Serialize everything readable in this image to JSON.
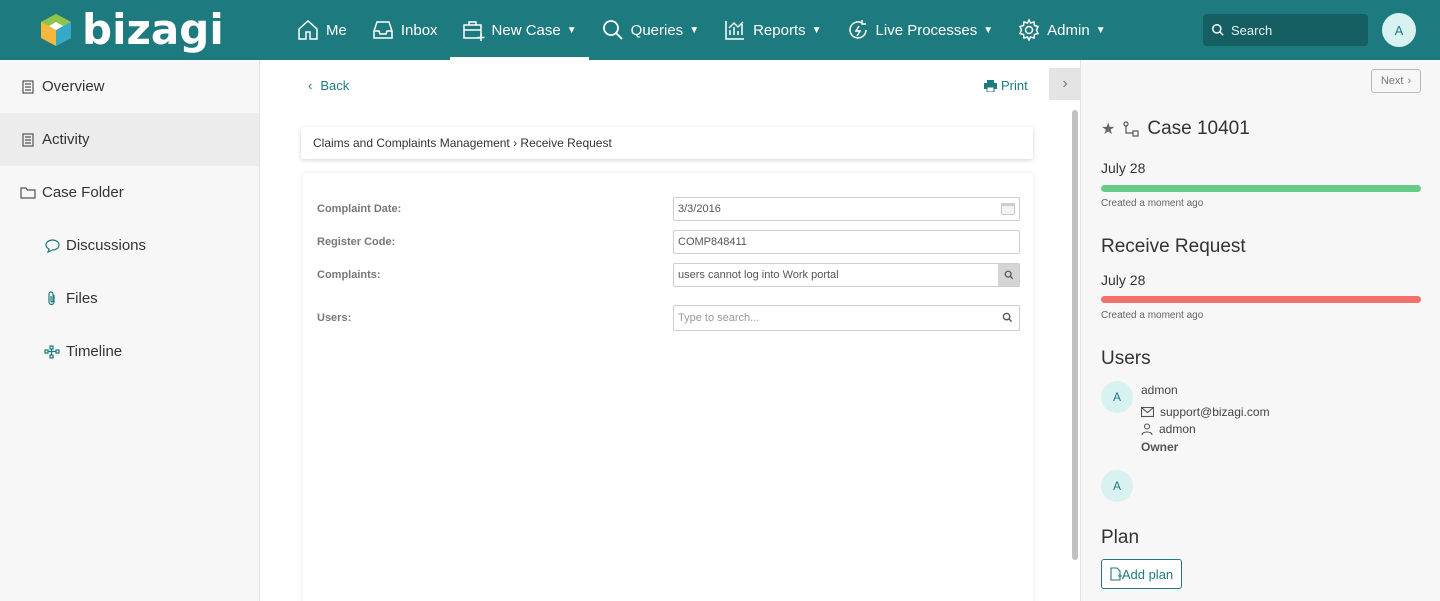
{
  "header": {
    "logo_text": "bizagi",
    "nav": [
      {
        "label": "Me",
        "icon": "home-icon",
        "dropdown": false
      },
      {
        "label": "Inbox",
        "icon": "inbox-icon",
        "dropdown": false
      },
      {
        "label": "New Case",
        "icon": "new-case-icon",
        "dropdown": true,
        "active": true
      },
      {
        "label": "Queries",
        "icon": "search-icon",
        "dropdown": true
      },
      {
        "label": "Reports",
        "icon": "reports-icon",
        "dropdown": true
      },
      {
        "label": "Live Processes",
        "icon": "live-processes-icon",
        "dropdown": true
      },
      {
        "label": "Admin",
        "icon": "gear-icon",
        "dropdown": true
      }
    ],
    "search_placeholder": "Search",
    "user_initial": "A"
  },
  "sidebar": {
    "items": [
      {
        "label": "Overview",
        "icon": "document-icon"
      },
      {
        "label": "Activity",
        "icon": "document-icon"
      },
      {
        "label": "Case Folder",
        "icon": "folder-icon"
      },
      {
        "label": "Discussions",
        "icon": "chat-icon"
      },
      {
        "label": "Files",
        "icon": "paperclip-icon"
      },
      {
        "label": "Timeline",
        "icon": "timeline-icon"
      }
    ]
  },
  "main": {
    "back_label": "Back",
    "print_label": "Print",
    "breadcrumb": "Claims and Complaints Management › Receive Request",
    "form": {
      "complaint_date_label": "Complaint Date:",
      "complaint_date_value": "3/3/2016",
      "register_code_label": "Register Code:",
      "register_code_value": "COMP848411",
      "complaints_label": "Complaints:",
      "complaints_value": "users cannot log into Work portal",
      "users_label": "Users:",
      "users_placeholder": "Type to search..."
    }
  },
  "right_panel": {
    "next_label": "Next",
    "case_title": "Case 10401",
    "case_date": "July 28",
    "case_created": "Created a moment ago",
    "case_bar_color": "#66cc88",
    "activity_title": "Receive Request",
    "activity_date": "July 28",
    "activity_created": "Created a moment ago",
    "activity_bar_color": "#f2706a",
    "users_heading": "Users",
    "user1": {
      "initial": "A",
      "name": "admon",
      "email": "support@bizagi.com",
      "username": "admon",
      "role": "Owner"
    },
    "user2_initial": "A",
    "plan_heading": "Plan",
    "add_plan_label": "Add plan"
  }
}
